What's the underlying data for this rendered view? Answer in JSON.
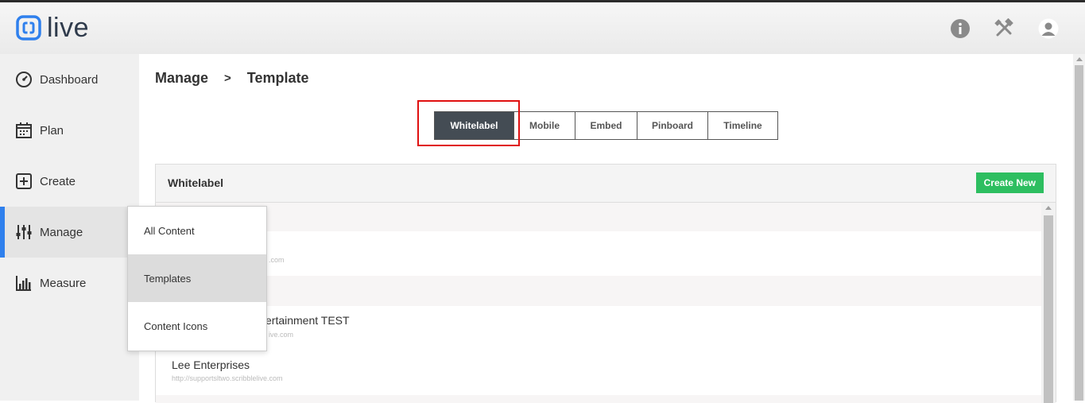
{
  "app": {
    "logo_text": "live"
  },
  "header": {
    "icons": [
      "info-icon",
      "tools-icon",
      "user-avatar-icon"
    ]
  },
  "sidebar": {
    "items": [
      {
        "label": "Dashboard",
        "icon": "dashboard-gauge-icon"
      },
      {
        "label": "Plan",
        "icon": "calendar-icon"
      },
      {
        "label": "Create",
        "icon": "plus-square-icon"
      },
      {
        "label": "Manage",
        "icon": "sliders-icon",
        "active": true
      },
      {
        "label": "Measure",
        "icon": "bar-chart-icon"
      }
    ]
  },
  "breadcrumb": {
    "parent": "Manage",
    "separator": ">",
    "current": "Template"
  },
  "tabs": [
    {
      "label": "Whitelabel",
      "active": true
    },
    {
      "label": "Mobile"
    },
    {
      "label": "Embed"
    },
    {
      "label": "Pinboard"
    },
    {
      "label": "Timeline"
    }
  ],
  "panel": {
    "title": "Whitelabel",
    "create_button": "Create New",
    "rows": [
      {
        "title": "",
        "url": ""
      },
      {
        "title": "",
        "url": ".com"
      },
      {
        "title": "",
        "url": ""
      },
      {
        "title": "ertainment TEST",
        "url": "ive.com"
      },
      {
        "title": "Lee Enterprises",
        "url": "http://supportsltwo.scribblelive.com"
      }
    ]
  },
  "dropdown": {
    "items": [
      {
        "label": "All Content"
      },
      {
        "label": "Templates",
        "active": true
      },
      {
        "label": "Content Icons"
      }
    ]
  },
  "colors": {
    "accent": "#2f80ed",
    "create": "#2dbe60",
    "active_tab": "#444c54",
    "highlight": "#e01010"
  }
}
